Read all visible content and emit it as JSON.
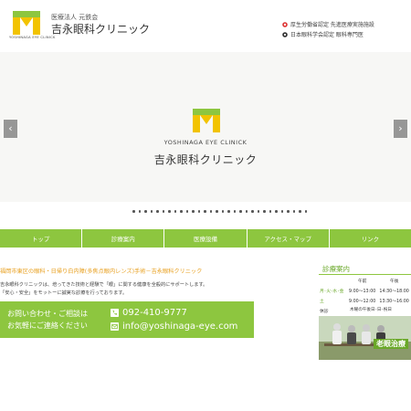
{
  "header": {
    "logo_subtitle": "YOSHINAGA EYE CLINICK",
    "corp": "医療法人 元鉄会",
    "clinic_name": "吉永眼科クリニック",
    "certs": [
      "厚生労働省認定 先進医療実施施設",
      "日本眼科学会認定 眼科専門医"
    ]
  },
  "slider": {
    "title_en": "YOSHINAGA EYE CLINICK",
    "title_jp": "吉永眼科クリニック",
    "prev_label": "‹",
    "next_label": "›",
    "dot_count": 30
  },
  "nav": [
    "トップ",
    "診療案内",
    "医療設備",
    "アクセス・マップ",
    "リンク"
  ],
  "main": {
    "headline": "福岡市東区の眼科・日帰り白内障(多焦点眼内レンズ)手術－吉永眼科クリニック",
    "desc1": "吉永眼科クリニックは、培ってきた技術と経験で「眼」に関する健康を全般的にサポートします。",
    "desc2": "「安心・安全」をモットーに誠実な診療を行っております。"
  },
  "contact": {
    "line1": "お問い合わせ・ご相談は",
    "line2": "お気軽にご連絡ください",
    "phone": "092-410-9777",
    "email": "info@yoshinaga-eye.com"
  },
  "schedule": {
    "title": "診療案内",
    "col_am": "午前",
    "col_pm": "午後",
    "rows": [
      {
        "day": "月･火･水･金",
        "am": "9:00～13:00",
        "pm": "14:30～18:00"
      },
      {
        "day": "土",
        "am": "9:00～12:00",
        "pm": "13:30～16:00"
      },
      {
        "day": "休診",
        "am": "",
        "pm": ""
      }
    ],
    "holiday_note": "木曜の午後日･日･祝日",
    "banner_label": "老眼治療"
  },
  "colors": {
    "accent": "#8dc63f",
    "logo_yellow": "#f2c300",
    "headline": "#e8a020"
  }
}
